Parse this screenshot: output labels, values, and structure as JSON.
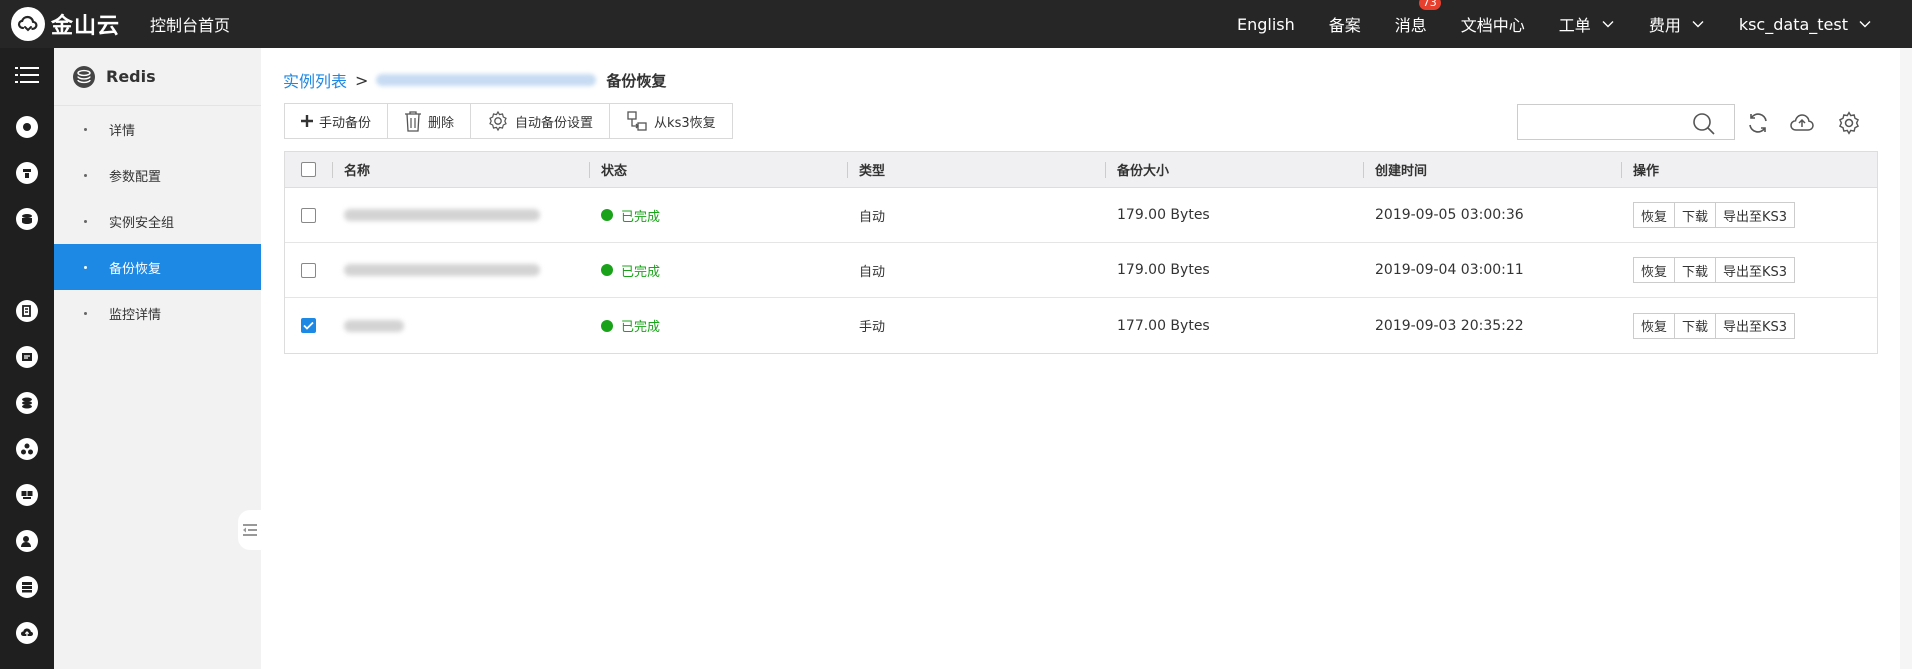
{
  "topbar": {
    "brand": "金山云",
    "console_home": "控制台首页",
    "nav": [
      {
        "label": "English",
        "has_dropdown": false
      },
      {
        "label": "备案",
        "has_dropdown": false
      },
      {
        "label": "消息",
        "has_dropdown": false,
        "badge": "73"
      },
      {
        "label": "文档中心",
        "has_dropdown": false
      },
      {
        "label": "工单",
        "has_dropdown": true
      },
      {
        "label": "费用",
        "has_dropdown": true
      },
      {
        "label": "ksc_data_test",
        "has_dropdown": true
      }
    ]
  },
  "rail": {
    "icons": [
      "menu-icon",
      "product-icon-1",
      "product-icon-2",
      "product-icon-3",
      "product-icon-4",
      "product-icon-5",
      "product-icon-6",
      "product-icon-7",
      "product-icon-8",
      "product-icon-9",
      "product-icon-10",
      "product-icon-11"
    ]
  },
  "subnav": {
    "title": "Redis",
    "items": [
      {
        "label": "详情",
        "active": false
      },
      {
        "label": "参数配置",
        "active": false
      },
      {
        "label": "实例安全组",
        "active": false
      },
      {
        "label": "备份恢复",
        "active": true
      },
      {
        "label": "监控详情",
        "active": false
      }
    ]
  },
  "breadcrumb": {
    "root": "实例列表",
    "separator": ">",
    "current": "备份恢复"
  },
  "toolbar": {
    "manual_backup": "手动备份",
    "delete": "删除",
    "auto_backup_settings": "自动备份设置",
    "restore_from_ks3": "从ks3恢复"
  },
  "search": {
    "placeholder": "",
    "value": ""
  },
  "table": {
    "headers": {
      "name": "名称",
      "status": "状态",
      "type": "类型",
      "size": "备份大小",
      "created": "创建时间",
      "ops": "操作"
    },
    "rows": [
      {
        "checked": false,
        "status": "已完成",
        "type": "自动",
        "size": "179.00 Bytes",
        "created": "2019-09-05 03:00:36"
      },
      {
        "checked": false,
        "status": "已完成",
        "type": "自动",
        "size": "179.00 Bytes",
        "created": "2019-09-04 03:00:11"
      },
      {
        "checked": true,
        "status": "已完成",
        "type": "手动",
        "size": "177.00 Bytes",
        "created": "2019-09-03 20:35:22"
      }
    ],
    "row_actions": {
      "restore": "恢复",
      "download": "下载",
      "export": "导出至KS3"
    }
  },
  "colors": {
    "topbar_bg": "#262626",
    "rail_bg": "#1f1f1f",
    "accent": "#1e88e5",
    "status_success": "#1aa31a"
  }
}
